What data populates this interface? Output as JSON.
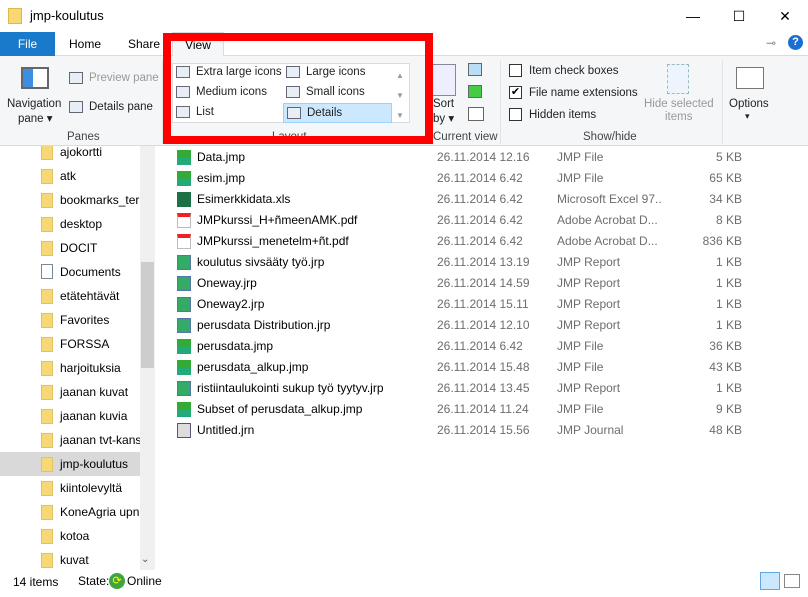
{
  "window": {
    "title": "jmp-koulutus",
    "minimize": "—",
    "maximize": "☐",
    "close": "✕"
  },
  "tabs": [
    {
      "label": "File"
    },
    {
      "label": "Home"
    },
    {
      "label": "Share"
    },
    {
      "label": "View"
    }
  ],
  "ribbon": {
    "panes": {
      "navigation_pane": "Navigation",
      "navigation_pane2": "pane ▾",
      "preview_pane": "Preview pane",
      "details_pane": "Details pane",
      "label": "Panes"
    },
    "layout": {
      "items": [
        "Extra large icons",
        "Large icons",
        "Medium icons",
        "Small icons",
        "List",
        "Details"
      ],
      "selected": "Details",
      "label": "Layout"
    },
    "current_view": {
      "sort": "Sort",
      "sort2": "by ▾",
      "label": "Current view"
    },
    "show_hide": {
      "item_check_boxes": {
        "label": "Item check boxes",
        "checked": false
      },
      "file_name_extensions": {
        "label": "File name extensions",
        "checked": true
      },
      "hidden_items": {
        "label": "Hidden items",
        "checked": false
      },
      "hide_selected": "Hide selected",
      "hide_selected2": "items",
      "label": "Show/hide"
    },
    "options": {
      "label": "Options",
      "arrow": "▾"
    }
  },
  "nav": {
    "items": [
      {
        "label": "ajokortti",
        "icon": "folder"
      },
      {
        "label": "atk",
        "icon": "folder"
      },
      {
        "label": "bookmarks_ter",
        "icon": "folder"
      },
      {
        "label": "desktop",
        "icon": "folder"
      },
      {
        "label": "DOCIT",
        "icon": "folder"
      },
      {
        "label": "Documents",
        "icon": "document"
      },
      {
        "label": "etätehtävät",
        "icon": "folder"
      },
      {
        "label": "Favorites",
        "icon": "folder"
      },
      {
        "label": "FORSSA",
        "icon": "folder"
      },
      {
        "label": "harjoituksia",
        "icon": "folder"
      },
      {
        "label": "jaanan kuvat",
        "icon": "folder"
      },
      {
        "label": "jaanan kuvia",
        "icon": "folder"
      },
      {
        "label": "jaanan tvt-kans",
        "icon": "folder"
      },
      {
        "label": "jmp-koulutus",
        "icon": "folder",
        "selected": true
      },
      {
        "label": "kiintolevyltä",
        "icon": "folder"
      },
      {
        "label": "KoneAgria upn",
        "icon": "folder"
      },
      {
        "label": "kotoa",
        "icon": "folder"
      },
      {
        "label": "kuvat",
        "icon": "folder"
      }
    ]
  },
  "files": [
    {
      "name": "Data.jmp",
      "date": "26.11.2014 12.16",
      "type": "JMP File",
      "size": "5 KB",
      "icon": "jmp"
    },
    {
      "name": "esim.jmp",
      "date": "26.11.2014 6.42",
      "type": "JMP File",
      "size": "65 KB",
      "icon": "jmp"
    },
    {
      "name": "Esimerkkidata.xls",
      "date": "26.11.2014 6.42",
      "type": "Microsoft Excel 97...",
      "size": "34 KB",
      "icon": "excel"
    },
    {
      "name": "JMPkurssi_H+ñmeenAMK.pdf",
      "date": "26.11.2014 6.42",
      "type": "Adobe Acrobat D...",
      "size": "8 KB",
      "icon": "pdf"
    },
    {
      "name": "JMPkurssi_menetelm+ñt.pdf",
      "date": "26.11.2014 6.42",
      "type": "Adobe Acrobat D...",
      "size": "836 KB",
      "icon": "pdf"
    },
    {
      "name": "koulutus sivsääty työ.jrp",
      "date": "26.11.2014 13.19",
      "type": "JMP Report",
      "size": "1 KB",
      "icon": "jrp"
    },
    {
      "name": "Oneway.jrp",
      "date": "26.11.2014 14.59",
      "type": "JMP Report",
      "size": "1 KB",
      "icon": "jrp"
    },
    {
      "name": "Oneway2.jrp",
      "date": "26.11.2014 15.11",
      "type": "JMP Report",
      "size": "1 KB",
      "icon": "jrp"
    },
    {
      "name": "perusdata Distribution.jrp",
      "date": "26.11.2014 12.10",
      "type": "JMP Report",
      "size": "1 KB",
      "icon": "jrp"
    },
    {
      "name": "perusdata.jmp",
      "date": "26.11.2014 6.42",
      "type": "JMP File",
      "size": "36 KB",
      "icon": "jmp"
    },
    {
      "name": "perusdata_alkup.jmp",
      "date": "26.11.2014 15.48",
      "type": "JMP File",
      "size": "43 KB",
      "icon": "jmp"
    },
    {
      "name": "ristiintaulukointi sukup työ tyytyv.jrp",
      "date": "26.11.2014 13.45",
      "type": "JMP Report",
      "size": "1 KB",
      "icon": "jrp"
    },
    {
      "name": "Subset of perusdata_alkup.jmp",
      "date": "26.11.2014 11.24",
      "type": "JMP File",
      "size": "9 KB",
      "icon": "jmp"
    },
    {
      "name": "Untitled.jrn",
      "date": "26.11.2014 15.56",
      "type": "JMP Journal",
      "size": "48 KB",
      "icon": "jrn"
    }
  ],
  "status": {
    "count": "14 items",
    "state": "State:",
    "online": "Online"
  },
  "colors": {
    "accent": "#1979ca",
    "highlight_box": "#ff0000",
    "selection": "#cce8ff"
  }
}
